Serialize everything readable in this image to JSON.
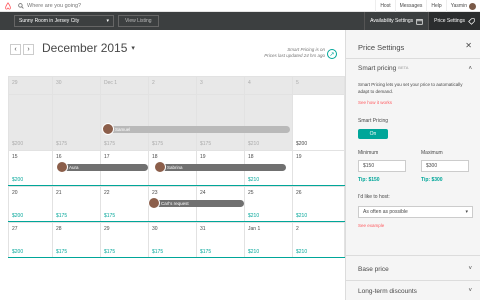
{
  "topbar": {
    "search_placeholder": "Where are you going?",
    "links": [
      "Host",
      "Messages",
      "Help",
      "Yasmin"
    ]
  },
  "listingbar": {
    "listing_name": "Sunny Room in Jersey City",
    "view_listing": "View Listing",
    "availability_settings": "Availability Settings",
    "price_settings": "Price Settings"
  },
  "calendar": {
    "month": "December 2015",
    "smart_note_line1": "Smart Pricing is on",
    "smart_note_line2": "Prices last updated 24 hrs ago",
    "weeks": [
      [
        {
          "d": "29",
          "p": "",
          "past": true
        },
        {
          "d": "30",
          "p": "",
          "past": true
        },
        {
          "d": "Dec 1",
          "p": "",
          "past": true
        },
        {
          "d": "2",
          "p": "",
          "past": true
        },
        {
          "d": "3",
          "p": "",
          "past": true
        },
        {
          "d": "4",
          "p": "",
          "past": true
        },
        {
          "d": "5",
          "p": "",
          "past": true
        }
      ],
      [
        {
          "d": "",
          "p": "$200",
          "past": true
        },
        {
          "d": "",
          "p": "$175",
          "past": true
        },
        {
          "d": "",
          "p": "$175",
          "past": true
        },
        {
          "d": "",
          "p": "$175",
          "past": true
        },
        {
          "d": "",
          "p": "$175",
          "past": true
        },
        {
          "d": "",
          "p": "$210",
          "past": true
        },
        {
          "d": "",
          "p": "$200",
          "past": false
        }
      ],
      [
        {
          "d": "15",
          "p": "$200",
          "past": false,
          "teal": true
        },
        {
          "d": "16",
          "p": "",
          "past": false
        },
        {
          "d": "17",
          "p": "",
          "past": false
        },
        {
          "d": "18",
          "p": "",
          "past": false
        },
        {
          "d": "19",
          "p": "",
          "past": false
        },
        {
          "d": "18",
          "p": "$210",
          "past": false,
          "teal": true
        },
        {
          "d": "19",
          "p": "",
          "past": false
        }
      ],
      [
        {
          "d": "20",
          "p": "$200",
          "past": false,
          "teal": true
        },
        {
          "d": "21",
          "p": "$175",
          "past": false,
          "teal": true
        },
        {
          "d": "22",
          "p": "$175",
          "past": false,
          "teal": true
        },
        {
          "d": "23",
          "p": "",
          "past": false
        },
        {
          "d": "24",
          "p": "",
          "past": false
        },
        {
          "d": "25",
          "p": "$210",
          "past": false,
          "teal": true
        },
        {
          "d": "26",
          "p": "$210",
          "past": false,
          "teal": true
        }
      ],
      [
        {
          "d": "27",
          "p": "$200",
          "past": false,
          "teal": true
        },
        {
          "d": "28",
          "p": "$175",
          "past": false,
          "teal": true
        },
        {
          "d": "29",
          "p": "$175",
          "past": false,
          "teal": true
        },
        {
          "d": "30",
          "p": "$175",
          "past": false,
          "teal": true
        },
        {
          "d": "31",
          "p": "$175",
          "past": false,
          "teal": true
        },
        {
          "d": "Jan 1",
          "p": "$210",
          "past": false,
          "teal": true
        },
        {
          "d": "2",
          "p": "$210",
          "past": false,
          "teal": true
        }
      ]
    ],
    "reservations": {
      "samuel": "Samuel",
      "aura": "Aura",
      "sabrina": "Sabrina",
      "carl": "Carl's request"
    }
  },
  "panel": {
    "title": "Price Settings",
    "smart_pricing": "Smart pricing",
    "beta": "BETA",
    "description": "Smart Pricing lets you set your price to automatically adapt to demand.",
    "how": "See how it works",
    "smart_pricing_label": "Smart Pricing",
    "toggle": "On",
    "minimum_label": "Minimum",
    "minimum_value": "$150",
    "minimum_tip": "Tip: $150",
    "maximum_label": "Maximum",
    "maximum_value": "$300",
    "maximum_tip": "Tip: $300",
    "host_label": "I'd like to host:",
    "host_value": "As often as possible",
    "example": "See example",
    "base_price": "Base price",
    "long_term": "Long-term discounts"
  }
}
